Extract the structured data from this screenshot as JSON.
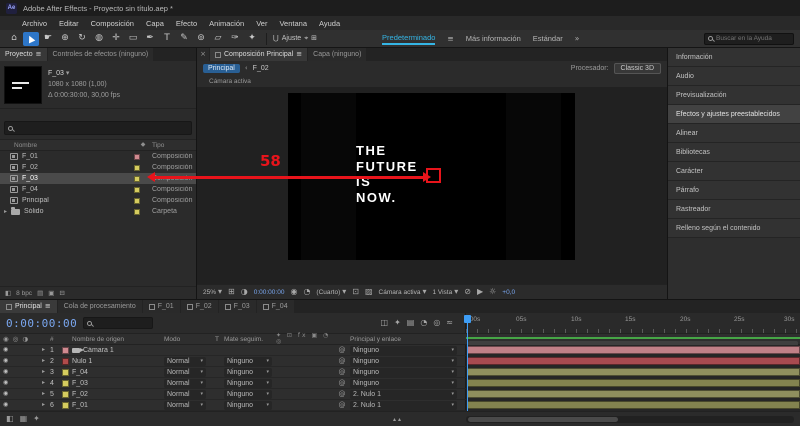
{
  "colors": {
    "accent_blue": "#2d76c8",
    "workspace_teal": "#35b5e5",
    "timecode_blue": "#7aa7f0",
    "annotation_red": "#e8141b",
    "cache_green": "#46a546",
    "selection_gray": "#4a4a4a"
  },
  "icons": {
    "app": "Ae",
    "home": "⌂",
    "selection": "▶",
    "hand": "☛",
    "zoom": "⊕",
    "orbit": "↻",
    "camera": "◍",
    "pan": "✛",
    "rect": "▭",
    "pen": "✒",
    "type": "T",
    "brush": "✎",
    "clone": "⊚",
    "eraser": "▱",
    "roto": "✑",
    "puppet": "✦",
    "magnet": "⋃",
    "target": "⌖",
    "grid": "⊞",
    "menu": "≡",
    "chevrons": "»",
    "dd": "▾",
    "back": "‹",
    "close": "×",
    "exp": "▸",
    "eye": "◉",
    "pw": "@",
    "tag": "◆",
    "interpret": "◧",
    "rows": "▤",
    "sq": "▣",
    "del": "⊟",
    "flow": "◫",
    "star": "✦",
    "pie": "◔",
    "circle": "◎",
    "wave": "≈",
    "half": "◑",
    "roi": "⊡",
    "hatch": "▨",
    "layout_a": "▥",
    "layout_b": "▦",
    "slash": "⊘",
    "play": "▶",
    "sun": "☼",
    "switches": "✦ ⊡ fx ▣ ◔ ◎",
    "zoom_markers": "▴▴"
  },
  "titlebar": {
    "title": "Adobe After Effects - Proyecto sin título.aep *"
  },
  "menubar": [
    "Archivo",
    "Editar",
    "Composición",
    "Capa",
    "Efecto",
    "Animación",
    "Ver",
    "Ventana",
    "Ayuda"
  ],
  "toolbar": {
    "snap_label": "Ajuste",
    "workspaces": [
      "Predeterminado",
      "Más información",
      "Estándar"
    ],
    "help_search_placeholder": "Buscar en la Ayuda"
  },
  "project": {
    "tab_project": "Proyecto",
    "tab_effects": "Controles de efectos (ninguno)",
    "preview_name": "F_03",
    "preview_dims": "1080 x 1080 (1,00)",
    "preview_fps": "Δ 0:00:30:00, 30,00 fps",
    "col_name": "Nombre",
    "col_type": "Tipo",
    "depth": "8 bpc",
    "items": [
      {
        "name": "F_01",
        "type": "Composición",
        "color": "#d08a90"
      },
      {
        "name": "F_02",
        "type": "Composición",
        "color": "#d5cc5f"
      },
      {
        "name": "F_03",
        "type": "Composición",
        "color": "#d5cc5f"
      },
      {
        "name": "F_04",
        "type": "Composición",
        "color": "#d5cc5f"
      },
      {
        "name": "Principal",
        "type": "Composición",
        "color": "#d5cc5f"
      },
      {
        "name": "Sólido",
        "type": "Carpeta",
        "color": "#d5cc5f"
      }
    ]
  },
  "comp": {
    "tab_label": "Composición Principal",
    "tab_layer": "Capa (ninguno)",
    "nav_current": "Principal",
    "nav_next": "F_02",
    "renderer_label": "Procesador:",
    "renderer_value": "Classic 3D",
    "view_label": "Cámara activa",
    "canvas_lines": [
      "THE",
      "FUTURE",
      "IS",
      "NOW."
    ],
    "zoom": "25%",
    "timecode": "0:00:00:00",
    "resolution": "(Cuarto)",
    "view3d": "Cámara activa",
    "layout": "1 Vista",
    "exposure": "+0,0"
  },
  "sidebar": {
    "items": [
      "Información",
      "Audio",
      "Previsualización",
      "Efectos y ajustes preestablecidos",
      "Alinear",
      "Bibliotecas",
      "Carácter",
      "Párrafo",
      "Rastreador",
      "Relleno según el contenido"
    ]
  },
  "annotation": {
    "number": "58"
  },
  "timeline": {
    "tabs": [
      "Principal",
      "Cola de procesamiento",
      "F_01",
      "F_02",
      "F_03",
      "F_04"
    ],
    "timecode": "0:00:00:00",
    "col_num": "#",
    "col_source": "Nombre de origen",
    "col_mode": "Modo",
    "col_t": "T",
    "col_matte": "Mate seguim.",
    "col_parent": "Principal y enlace",
    "ruler": [
      ":00s",
      "05s",
      "10s",
      "15s",
      "20s",
      "25s",
      "30s"
    ],
    "layers": [
      {
        "num": "1",
        "name": "Cámara 1",
        "mode": "",
        "matte": "",
        "parent": "Ninguno",
        "swatch": "#d08a90",
        "bar": "#c08087"
      },
      {
        "num": "2",
        "name": "Nulo 1",
        "mode": "Normal",
        "matte": "Ninguno",
        "parent": "Ninguno",
        "swatch": "#b04b4b",
        "bar": "#a84a50"
      },
      {
        "num": "3",
        "name": "F_04",
        "mode": "Normal",
        "matte": "Ninguno",
        "parent": "Ninguno",
        "swatch": "#d5cc5f",
        "bar": "#8f8f5e"
      },
      {
        "num": "4",
        "name": "F_03",
        "mode": "Normal",
        "matte": "Ninguno",
        "parent": "Ninguno",
        "swatch": "#d5cc5f",
        "bar": "#83834f"
      },
      {
        "num": "5",
        "name": "F_02",
        "mode": "Normal",
        "matte": "Ninguno",
        "parent": "2. Nulo 1",
        "swatch": "#d5cc5f",
        "bar": "#8f8f5e"
      },
      {
        "num": "6",
        "name": "F_01",
        "mode": "Normal",
        "matte": "Ninguno",
        "parent": "2. Nulo 1",
        "swatch": "#d5cc5f",
        "bar": "#83834f"
      }
    ]
  }
}
